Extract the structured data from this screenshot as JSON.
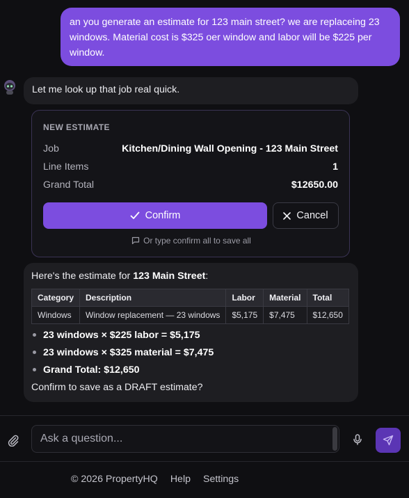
{
  "user_message": "an you generate an estimate for 123 main street? we are replaceing 23 windows. Material cost is $325  oer window and labor will be $225 per window.",
  "assistant_reply_1": "Let me look up that job real quick.",
  "estimate_card": {
    "title": "NEW ESTIMATE",
    "rows": [
      {
        "label": "Job",
        "value": "Kitchen/Dining Wall Opening - 123 Main Street"
      },
      {
        "label": "Line Items",
        "value": "1"
      },
      {
        "label": "Grand Total",
        "value": "$12650.00"
      }
    ],
    "confirm_label": "Confirm",
    "cancel_label": "Cancel",
    "hint": "Or type confirm all to save all"
  },
  "assistant_reply_2": {
    "intro_prefix": "Here's the estimate for ",
    "intro_bold": "123 Main Street",
    "intro_suffix": ":",
    "table": {
      "headers": [
        "Category",
        "Description",
        "Labor",
        "Material",
        "Total"
      ],
      "rows": [
        [
          "Windows",
          "Window replacement — 23 windows",
          "$5,175",
          "$7,475",
          "$12,650"
        ]
      ]
    },
    "bullets": [
      "23 windows × $225 labor = $5,175",
      "23 windows × $325 material = $7,475",
      "Grand Total: $12,650"
    ],
    "outro": "Confirm to save as a DRAFT estimate?"
  },
  "input": {
    "placeholder": "Ask a question...",
    "value": ""
  },
  "footer": {
    "copyright": "© 2026 PropertyHQ",
    "help": "Help",
    "settings": "Settings"
  },
  "colors": {
    "accent": "#7c4ddf",
    "background": "#0f0f12",
    "bubble": "#1e1e22"
  }
}
